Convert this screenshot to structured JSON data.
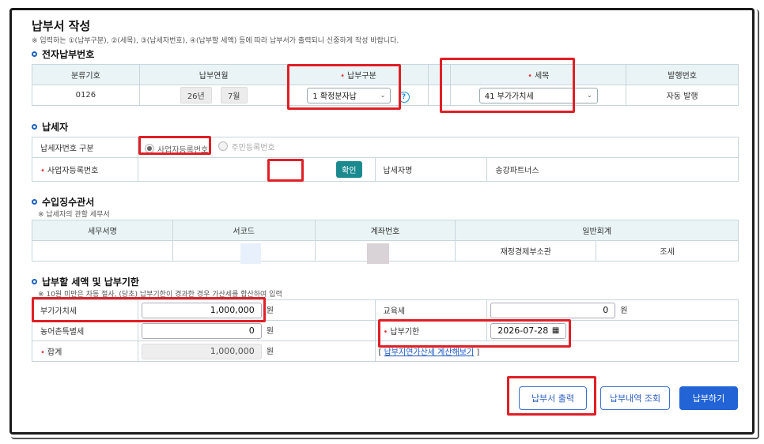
{
  "page": {
    "title": "납부서 작성",
    "note": "※ 입력하는 ①(납부구분), ②(세목), ③(납세자번호), ④(납부할 세액) 등에 따라 납부서가 출력되니 신중하게 작성 바랍니다."
  },
  "section1": {
    "title": "전자납부번호",
    "headers": [
      "분류기호",
      "납부연월",
      "납부구분",
      "세목",
      "발행번호"
    ],
    "classification_code": "0126",
    "year": "26년",
    "month": "7월",
    "payment_type": "1 확정분자납",
    "tax_item": "41 부가가치세",
    "issue_number": "자동 발행"
  },
  "section2": {
    "title": "납세자",
    "id_type_label": "납세자번호 구분",
    "radio_business": "사업자등록번호",
    "radio_resident": "주민등록번호",
    "brn_label": "사업자등록번호",
    "confirm_button": "확인",
    "taxpayer_name_label": "납세자명",
    "taxpayer_name": "송강파트너스"
  },
  "section3": {
    "title": "수입징수관서",
    "note": "※ 납세자의 관할 세무서",
    "headers": [
      "세무서명",
      "서코드",
      "계좌번호",
      "일반회계"
    ],
    "sub_headers": [
      "재정경제부소관",
      "조세"
    ]
  },
  "section4": {
    "title": "납부할 세액 및 납부기한",
    "note": "※ 10원 미만은 자동 절사, (당초) 납부기한이 경과한 경우 가산세를 합산하여 입력",
    "vat_label": "부가가치세",
    "vat_value": "1,000,000",
    "edu_label": "교육세",
    "edu_value": "0",
    "rural_label": "농어촌특별세",
    "rural_value": "0",
    "due_label": "납부기한",
    "due_value": "2026-07-28",
    "total_label": "합계",
    "total_value": "1,000,000",
    "unit": "원",
    "late_fee_link": "납부지연가산세 계산해보기"
  },
  "buttons": {
    "print": "납부서 출력",
    "history": "납부내역 조회",
    "pay": "납부하기"
  },
  "colors": {
    "accent": "#2263d6",
    "teal": "#1a8a8f",
    "highlight": "#e01f26",
    "header_bg": "#eaf4f6"
  }
}
